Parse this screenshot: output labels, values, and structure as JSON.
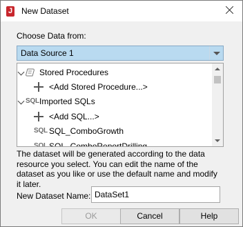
{
  "window": {
    "title": "New Dataset"
  },
  "choose_label": "Choose Data from:",
  "data_source": {
    "selected": "Data Source 1"
  },
  "tree": {
    "stored_procedures": "Stored Procedures",
    "add_stored_procedure": "<Add Stored Procedure...>",
    "imported_sqls": "Imported SQLs",
    "sql_icon_text": "SQL",
    "add_sql": "<Add SQL...>",
    "sql_items": [
      "SQL_ComboGrowth",
      "SQL_ComboReportDrilling"
    ]
  },
  "info_text": "The dataset will be generated according to the data resource you select. You can edit the name of the dataset as you like or use the default name and modify it later.",
  "name_label": "New Dataset Name:",
  "name_value": "DataSet1",
  "buttons": {
    "ok": "OK",
    "cancel": "Cancel",
    "help": "Help"
  },
  "colors": {
    "selection": "#b9daf0",
    "app_icon": "#c8272d"
  }
}
